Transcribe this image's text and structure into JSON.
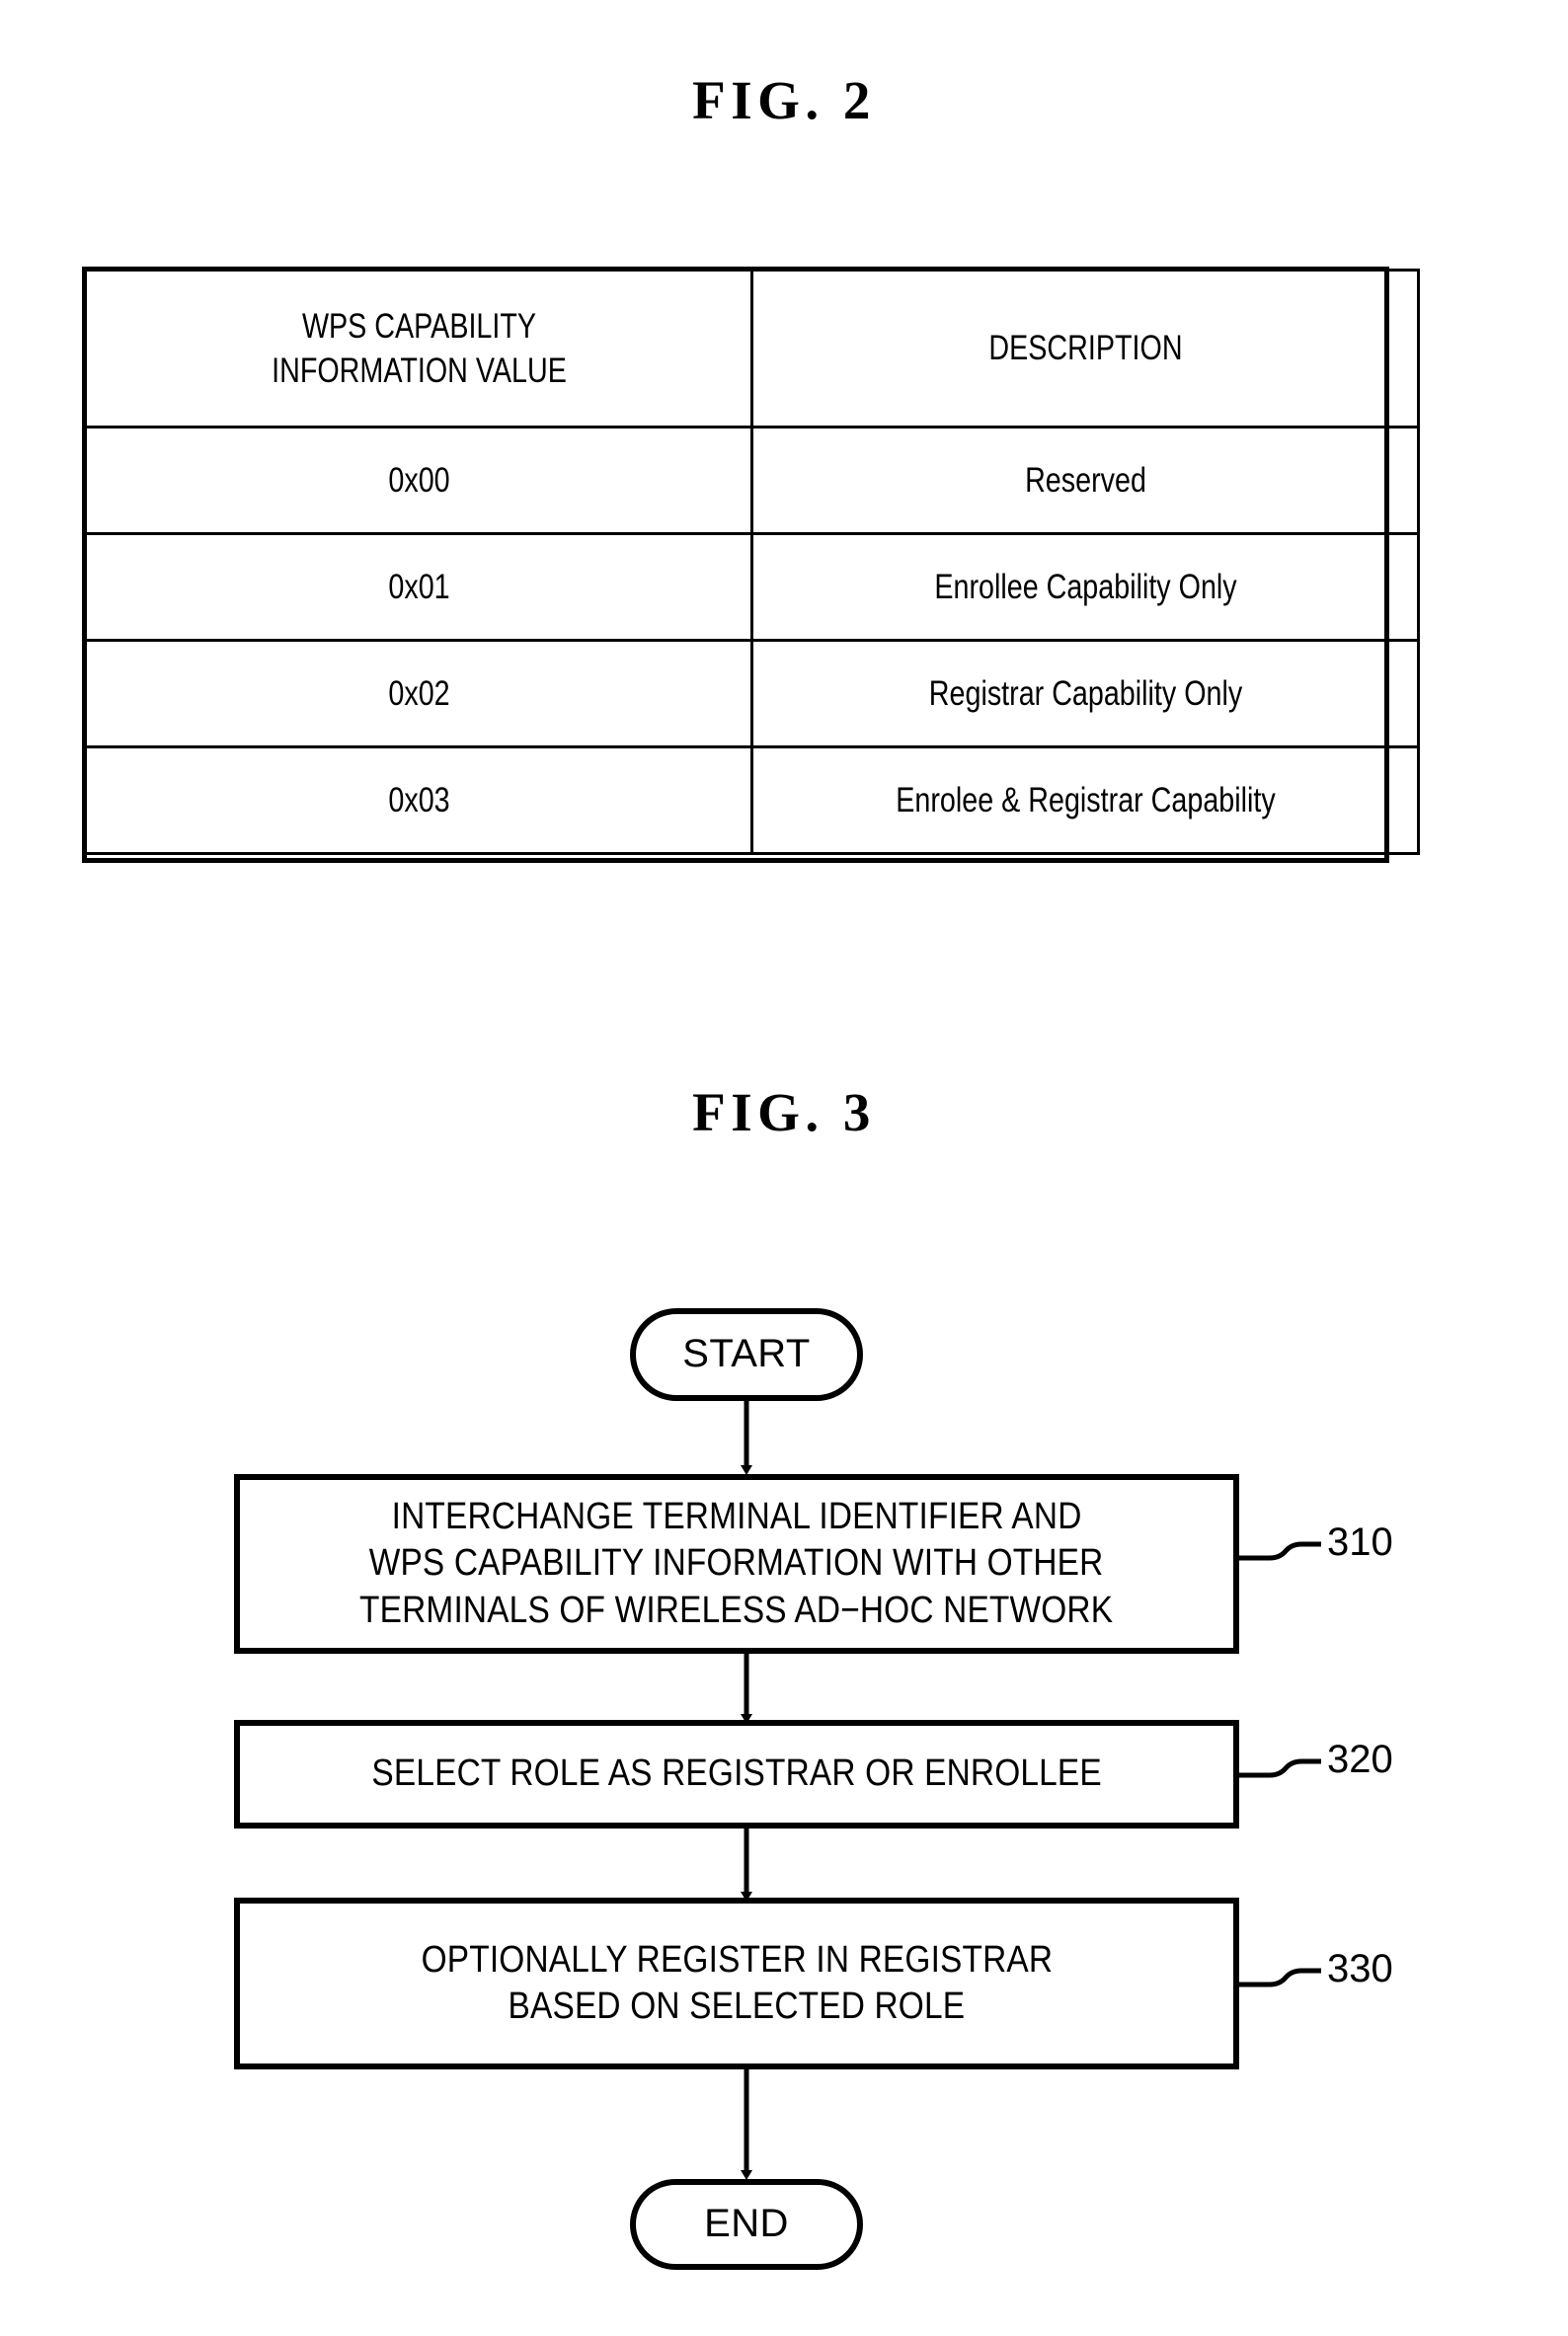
{
  "figures": {
    "fig2": {
      "title": "FIG.  2",
      "table": {
        "headers": {
          "left_line1": "WPS CAPABILITY",
          "left_line2": "INFORMATION VALUE",
          "right": "DESCRIPTION"
        },
        "rows": [
          {
            "value": "0x00",
            "description": "Reserved"
          },
          {
            "value": "0x01",
            "description": "Enrollee Capability Only"
          },
          {
            "value": "0x02",
            "description": "Registrar Capability Only"
          },
          {
            "value": "0x03",
            "description": "Enrolee & Registrar Capability"
          }
        ]
      }
    },
    "fig3": {
      "title": "FIG.  3",
      "start_label": "START",
      "end_label": "END",
      "steps": [
        {
          "ref": "310",
          "line1": "INTERCHANGE TERMINAL IDENTIFIER AND",
          "line2": "WPS CAPABILITY INFORMATION WITH OTHER",
          "line3": "TERMINALS OF WIRELESS AD−HOC NETWORK"
        },
        {
          "ref": "320",
          "line1": "SELECT ROLE AS REGISTRAR OR ENROLLEE",
          "line2": "",
          "line3": ""
        },
        {
          "ref": "330",
          "line1": "OPTIONALLY REGISTER IN REGISTRAR",
          "line2": "BASED ON SELECTED ROLE",
          "line3": ""
        }
      ]
    }
  },
  "colors": {
    "ink": "#000000",
    "page": "#ffffff"
  }
}
